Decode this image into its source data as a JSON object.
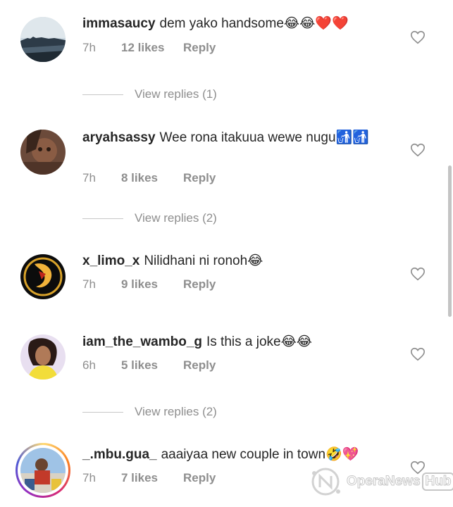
{
  "comments": [
    {
      "username": "immasaucy",
      "text": "dem yako handsome",
      "emoji": "😂😂❤️❤️",
      "time": "7h",
      "likes": "12 likes",
      "reply": "Reply",
      "view_replies": "View replies (1)"
    },
    {
      "username": "aryahsassy",
      "text": "Wee rona itakuua wewe nugu",
      "emoji": "🚮🚮",
      "time": "7h",
      "likes": "8 likes",
      "reply": "Reply",
      "view_replies": "View replies (2)"
    },
    {
      "username": "x_limo_x",
      "text": "Nilidhani ni ronoh",
      "emoji": "😂",
      "time": "7h",
      "likes": "9 likes",
      "reply": "Reply"
    },
    {
      "username": "iam_the_wambo_g",
      "text": "Is this a joke",
      "emoji": "😂😂",
      "time": "6h",
      "likes": "5 likes",
      "reply": "Reply",
      "view_replies": "View replies (2)"
    },
    {
      "username": "_.mbu.gua_",
      "text": "aaaiyaa new couple in town",
      "emoji": "🤣💖",
      "time": "7h",
      "likes": "7 likes",
      "reply": "Reply"
    }
  ],
  "watermark": {
    "brand": "OperaNews",
    "suffix": "Hub"
  },
  "icons": {
    "like": "heart-outline-icon",
    "watermark_logo": "operanews-logo-icon"
  },
  "colors": {
    "primary_text": "#262626",
    "secondary_text": "#8e8e8e",
    "divider": "#c7c7c7",
    "background": "#ffffff"
  }
}
